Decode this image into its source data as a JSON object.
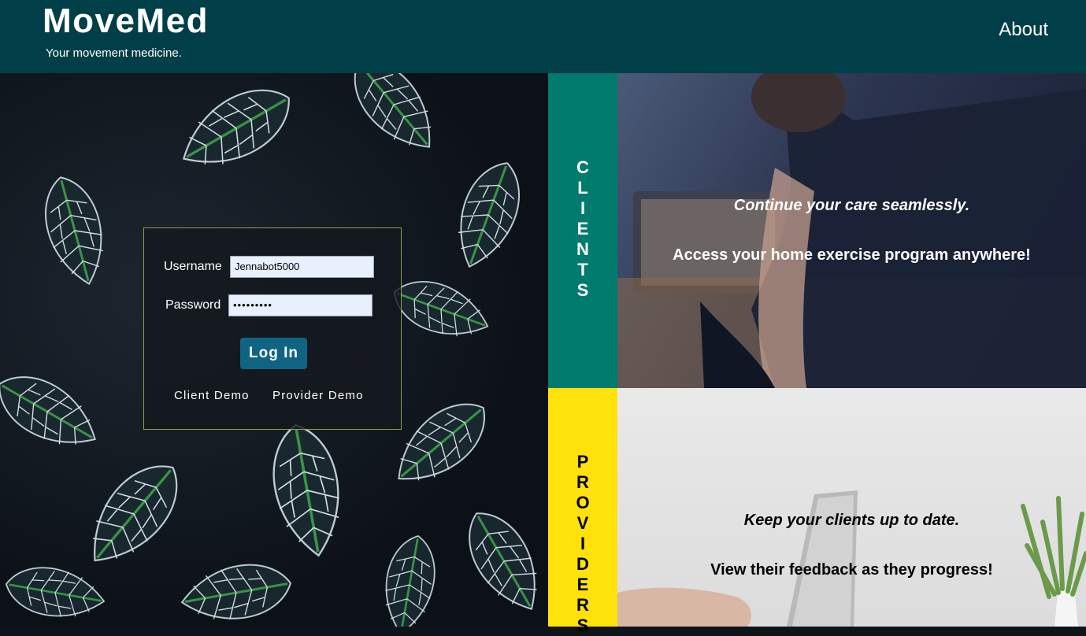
{
  "header": {
    "brand": "MoveMed",
    "tagline": "Your movement medicine.",
    "about_label": "About"
  },
  "login": {
    "username_label": "Username",
    "username_value": "Jennabot5000",
    "password_label": "Password",
    "password_value": "•••••••••",
    "login_button": "Log In",
    "client_demo": "Client Demo",
    "provider_demo": "Provider Demo"
  },
  "clients": {
    "side_label": [
      "C",
      "L",
      "I",
      "E",
      "N",
      "T",
      "S"
    ],
    "headline": "Continue your care seamlessly.",
    "subline": "Access your home exercise program anywhere!"
  },
  "providers": {
    "side_label": [
      "P",
      "R",
      "O",
      "V",
      "I",
      "D",
      "E",
      "R",
      "S"
    ],
    "headline": "Keep your clients up to date.",
    "subline": "View their feedback as they progress!"
  },
  "colors": {
    "header_bg": "#003f47",
    "clients_accent": "#007b6e",
    "providers_accent": "#ffe10c",
    "button_bg": "#0e6482",
    "card_border": "#8da04a"
  }
}
